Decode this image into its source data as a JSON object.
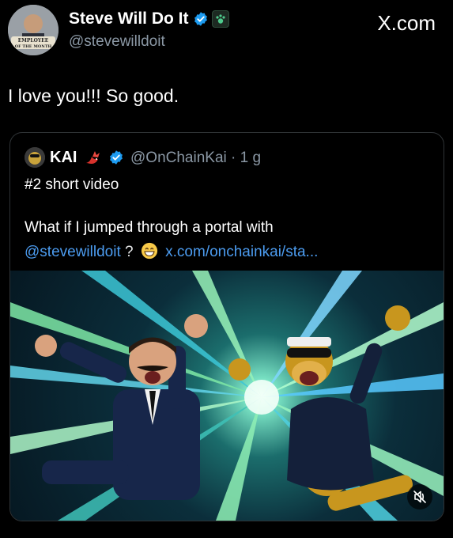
{
  "author": {
    "display_name": "Steve Will Do It",
    "handle": "@stevewilldoit",
    "avatar_badge_line1": "EMPLOYEE",
    "avatar_badge_line2": "OF THE MONTH"
  },
  "brand": {
    "label": "X.com"
  },
  "tweet": {
    "text": "I love you!!! So good."
  },
  "quote": {
    "name": "KAI",
    "handle_time": "@OnChainKai · 1 g",
    "line1": "#2 short video",
    "line2": "What if I jumped through a portal with",
    "mention": "@stevewilldoit",
    "after_mention": " ?",
    "link": "x.com/onchainkai/sta..."
  },
  "colors": {
    "background": "#000000",
    "text": "#ffffff",
    "muted": "#8b98a5",
    "link": "#4c9cf0",
    "verified": "#1d9bf0",
    "card_border": "#2f3336"
  },
  "icons": {
    "verified": "verified-badge-icon",
    "affiliate": "affiliate-paw-icon",
    "emoji_flag": "dragon-emoji-icon",
    "grin": "grinning-emoji-icon",
    "mute": "muted-speaker-icon"
  }
}
